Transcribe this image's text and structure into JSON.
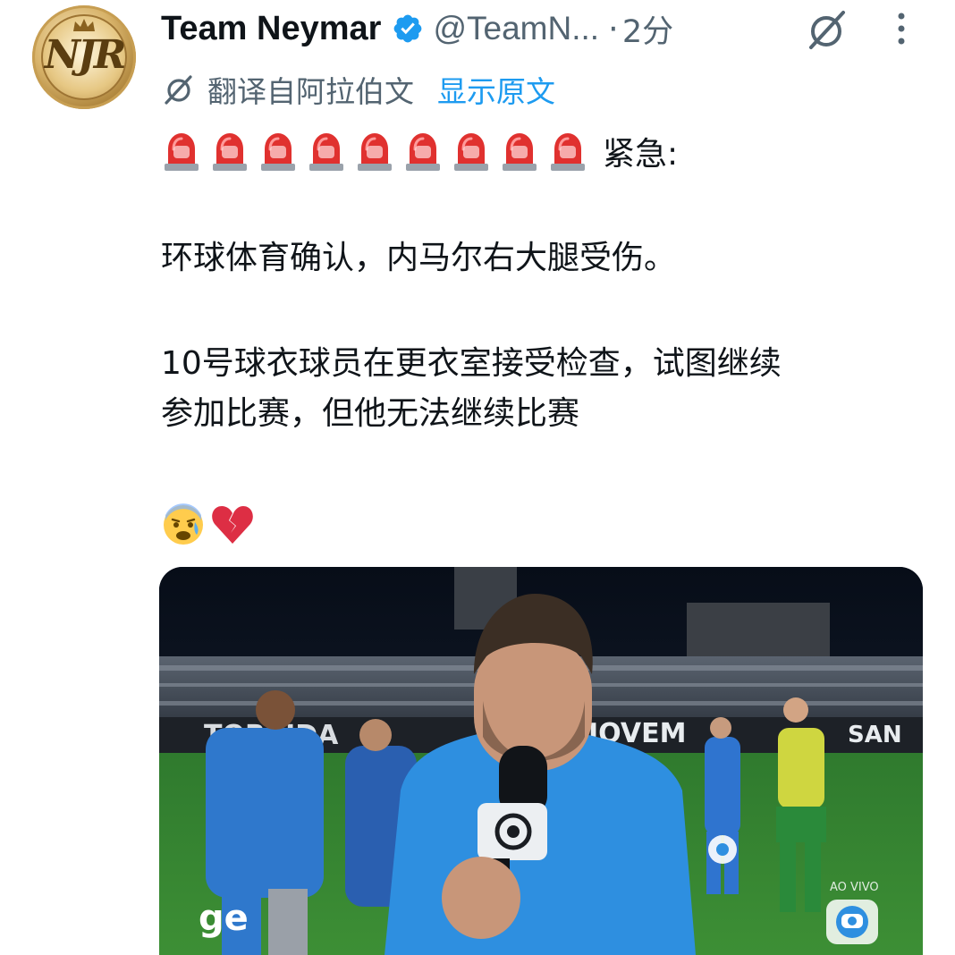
{
  "author": {
    "name": "Team Neymar",
    "handle": "@TeamN...",
    "separator": "·",
    "time": "2分",
    "avatar_monogram": "NJR",
    "verified_color": "#1d9bf0"
  },
  "translation": {
    "translated_label": "翻译自阿拉伯文",
    "show_original_label": "显示原文"
  },
  "post": {
    "siren_count": 9,
    "urgent_label": "紧急:",
    "paragraph_1": "环球体育确认，内马尔右大腿受伤。",
    "paragraph_2_line_1": "10号球衣球员在更衣室接受检查，试图继续",
    "paragraph_2_line_2": "参加比赛，但他无法继续比赛",
    "emojis": [
      "face-with-anxious-sweat",
      "broken-heart"
    ]
  },
  "media": {
    "banner_text_left": "TORCIDA",
    "banner_text_mid": "JOVEM",
    "banner_text_right": "SAN",
    "broadcaster_logo": "ge",
    "live_label": "AO VIVO"
  },
  "colors": {
    "accent": "#1d9bf0",
    "secondary_text": "#536471",
    "primary_text": "#0f1419"
  }
}
